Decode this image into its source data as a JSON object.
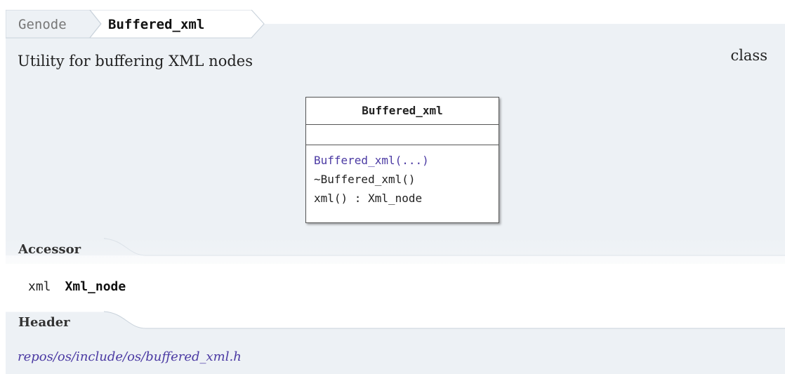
{
  "breadcrumb": {
    "parent": "Genode",
    "current": "Buffered_xml"
  },
  "summary": "Utility for buffering XML nodes",
  "kind": "class",
  "uml": {
    "title": "Buffered_xml",
    "operations": [
      {
        "label": "Buffered_xml(...)",
        "link": true
      },
      {
        "label": "~Buffered_xml()",
        "link": false
      },
      {
        "label": "xml() : Xml_node",
        "link": false
      }
    ]
  },
  "accessor_section": {
    "title": "Accessor",
    "name": "xml",
    "type": "Xml_node"
  },
  "header_section": {
    "title": "Header",
    "path": "repos/os/include/os/buffered_xml.h"
  },
  "colors": {
    "panel": "#edf1f5",
    "link": "#4b3aa3"
  }
}
